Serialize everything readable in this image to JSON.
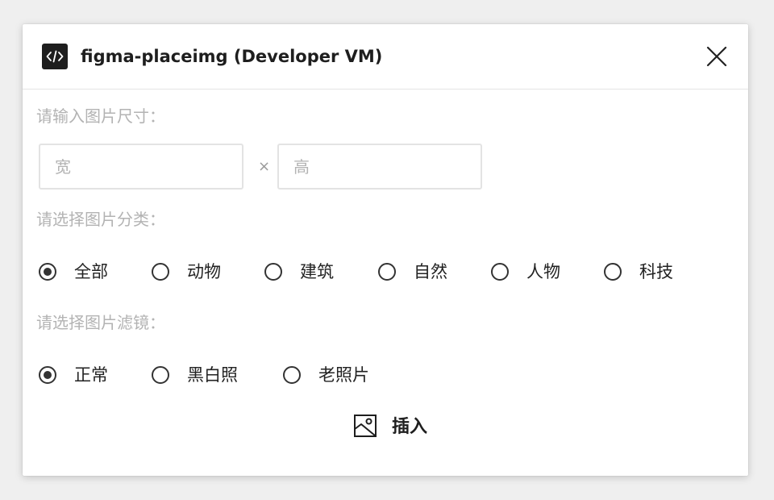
{
  "dialog": {
    "title": "figma-placeimg (Developer VM)",
    "app_icon": "code-icon",
    "close_icon": "close-icon"
  },
  "size": {
    "label": "请输入图片尺寸：",
    "width_placeholder": "宽",
    "height_placeholder": "高",
    "separator": "×"
  },
  "category": {
    "label": "请选择图片分类：",
    "options": [
      {
        "label": "全部",
        "checked": true
      },
      {
        "label": "动物",
        "checked": false
      },
      {
        "label": "建筑",
        "checked": false
      },
      {
        "label": "自然",
        "checked": false
      },
      {
        "label": "人物",
        "checked": false
      },
      {
        "label": "科技",
        "checked": false
      }
    ]
  },
  "filter": {
    "label": "请选择图片滤镜：",
    "options": [
      {
        "label": "正常",
        "checked": true
      },
      {
        "label": "黑白照",
        "checked": false
      },
      {
        "label": "老照片",
        "checked": false
      }
    ]
  },
  "insert": {
    "label": "插入",
    "icon": "image-icon"
  }
}
